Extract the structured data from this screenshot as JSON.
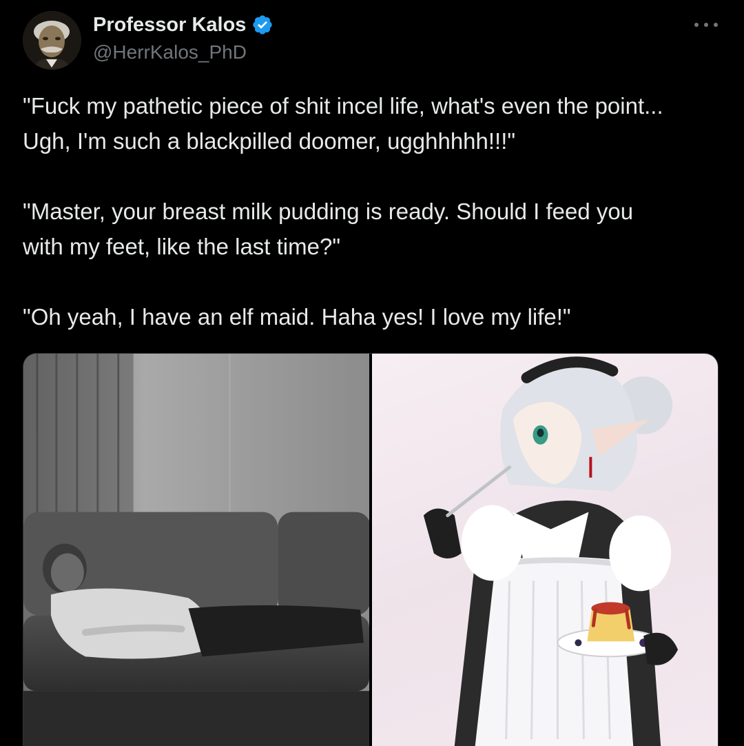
{
  "author": {
    "display_name": "Professor Kalos",
    "handle": "@HerrKalos_PhD",
    "avatar_icon": "avatar-portrait",
    "verified_icon": "verified-badge-icon",
    "verified_color": "#1d9bf0"
  },
  "more_icon": "more-options-icon",
  "tweet": {
    "paragraphs": [
      "\"Fuck my pathetic piece of shit incel life, what's even the point...\nUgh, I'm such a blackpilled doomer, ugghhhhh!!!\"",
      "\"Master, your breast milk pudding is ready. Should I feed you\nwith my feet, like the last time?\"",
      "\"Oh yeah, I have an elf maid. Haha yes! I love my life!\""
    ]
  },
  "media": {
    "images": [
      {
        "name": "man-lying-on-couch-photo"
      },
      {
        "name": "elf-maid-illustration"
      }
    ]
  },
  "colors": {
    "background": "#000000",
    "text_primary": "#e7e9ea",
    "text_secondary": "#71767b",
    "accent": "#1d9bf0"
  }
}
